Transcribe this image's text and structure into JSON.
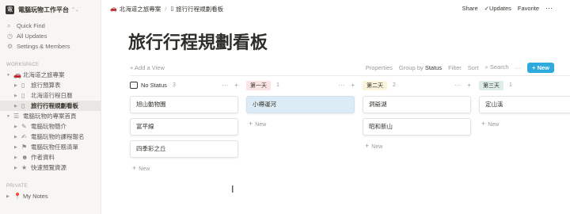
{
  "sidebar": {
    "workspace_initial": "電",
    "workspace_name": "電腦玩物工作平台",
    "nav": [
      {
        "icon": "⌕",
        "label": "Quick Find"
      },
      {
        "icon": "◷",
        "label": "All Updates"
      },
      {
        "icon": "⚙",
        "label": "Settings & Members"
      }
    ],
    "section_workspace": "WORKSPACE",
    "tree": [
      {
        "label": "北海道之旅專案"
      },
      {
        "label": "旅行預算表"
      },
      {
        "label": "北海道行程日曆"
      },
      {
        "label": "旅行行程規劃看板"
      },
      {
        "label": "電腦玩物的專案首頁"
      },
      {
        "label": "電腦玩物簡介"
      },
      {
        "label": "電腦玩物的課程報名"
      },
      {
        "label": "電腦玩物任務清單"
      },
      {
        "label": "作者資料"
      },
      {
        "label": "快速預覽資源"
      }
    ],
    "section_private": "PRIVATE",
    "private_item": "My Notes"
  },
  "topbar": {
    "crumb1": "北海道之旅專案",
    "crumb2": "旅行行程規劃看板",
    "share": "Share",
    "updates": "Updates",
    "favorite": "Favorite",
    "more": "···"
  },
  "page": {
    "title": "旅行行程規劃看板"
  },
  "viewbar": {
    "add_view": "+ Add a View",
    "properties": "Properties",
    "group_by": "Group by",
    "group_value": "Status",
    "filter": "Filter",
    "sort": "Sort",
    "search": "Search",
    "more": "···",
    "new": "New"
  },
  "board": {
    "columns": [
      {
        "title": "No Status",
        "count": "3",
        "cards": [
          "旭山動物園",
          "富平線",
          "四季彩之丘"
        ],
        "add": "New",
        "color": "#ffffff"
      },
      {
        "title": "第一天",
        "count": "1",
        "cards": [
          "小樽運河"
        ],
        "add": "New",
        "color": "#fbe4e4"
      },
      {
        "title": "第二天",
        "count": "2",
        "cards": [
          "洞爺湖",
          "昭和新山"
        ],
        "add": "New",
        "color": "#fbf3db"
      },
      {
        "title": "第三天",
        "count": "1",
        "cards": [
          "定山溪"
        ],
        "add": "New",
        "color": "#ddedea"
      }
    ]
  },
  "colors": {
    "accent": "#2eaadc",
    "sidebar_bg": "#f7f6f3",
    "card_highlight": "#dcecf6"
  }
}
